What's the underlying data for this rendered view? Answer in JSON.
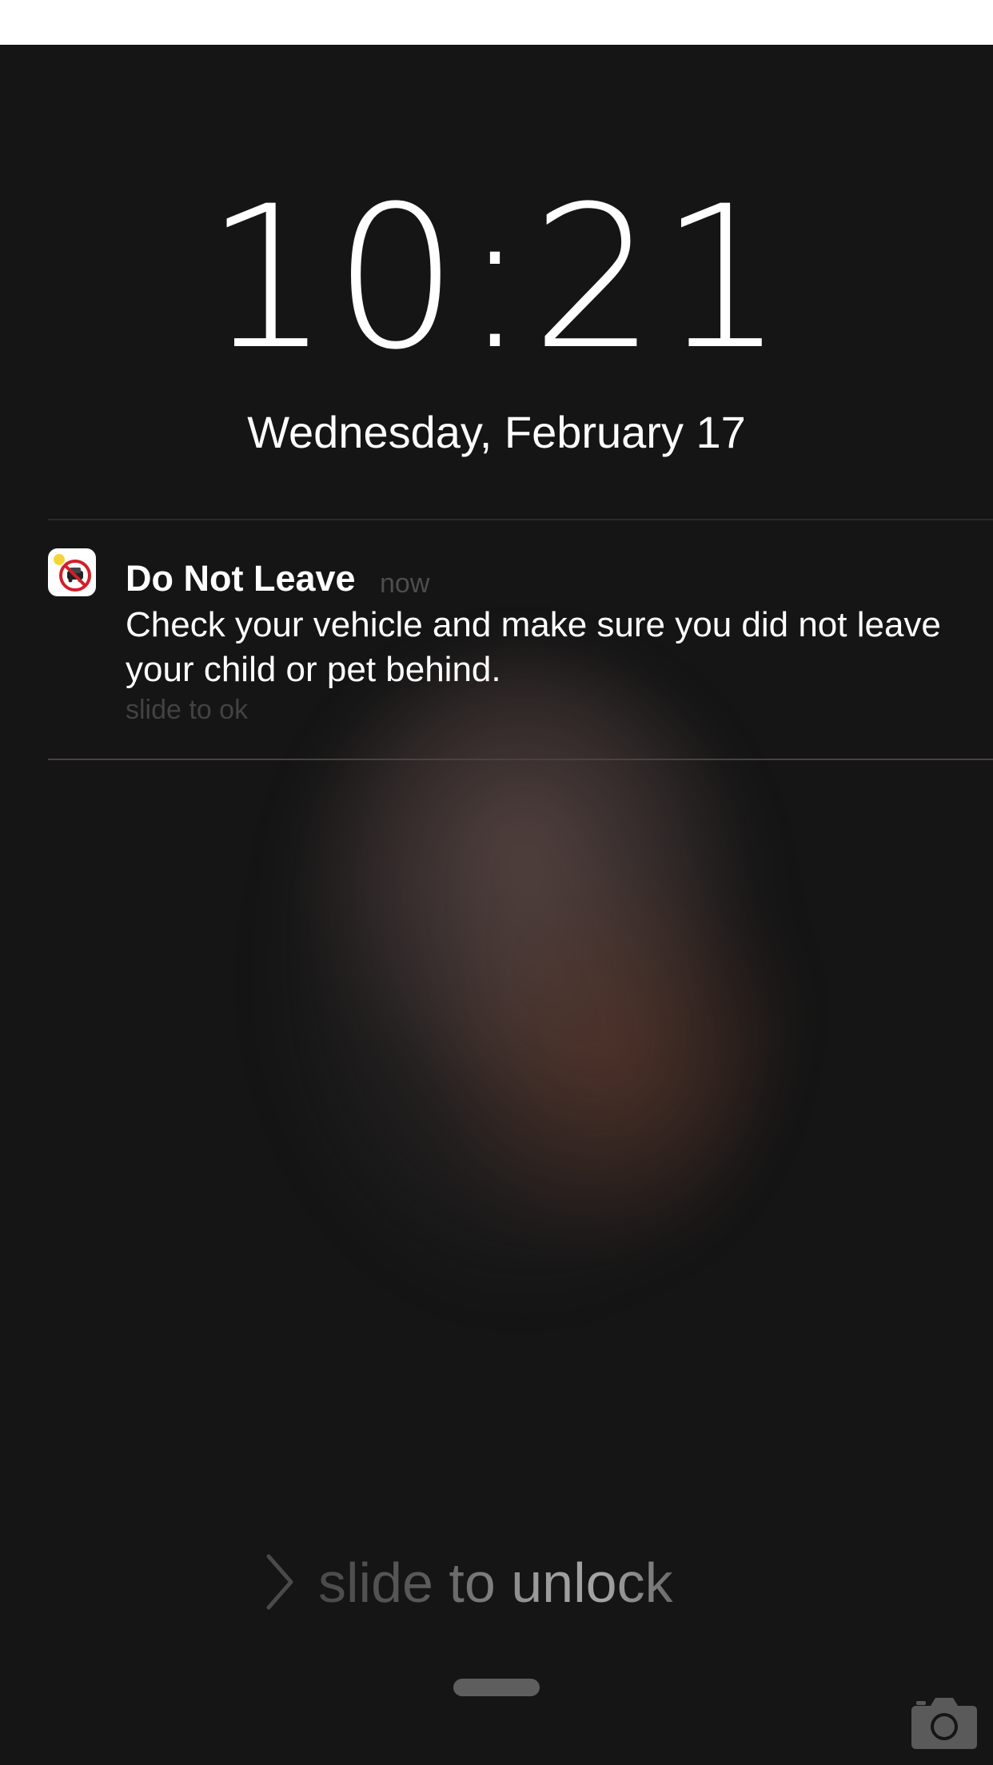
{
  "lock_screen": {
    "time": "10:21",
    "date": "Wednesday, February 17"
  },
  "notification": {
    "icon": "do-not-leave-app-icon",
    "title": "Do Not Leave",
    "time": "now",
    "body": "Check your vehicle and make sure you did not leave your child or pet behind.",
    "action": "slide to ok"
  },
  "unlock": {
    "label": "slide to unlock",
    "icon": "chevron-right-icon"
  },
  "bottom": {
    "home_indicator": "home-indicator",
    "camera_icon": "camera-icon"
  },
  "colors": {
    "background": "#151515",
    "text": "#ffffff",
    "muted": "#4d4d4d"
  }
}
